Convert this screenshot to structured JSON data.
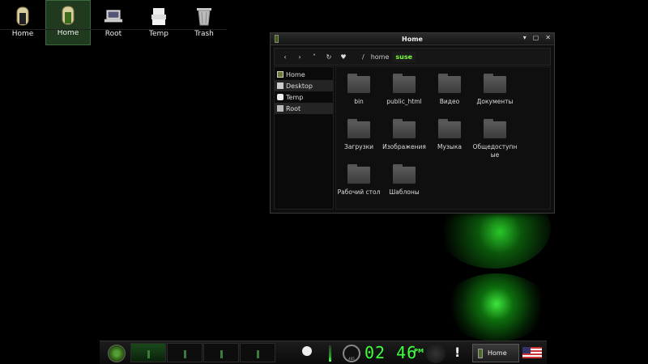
{
  "desktop": {
    "icons": [
      {
        "label": "Home"
      },
      {
        "label": "Home"
      },
      {
        "label": "Root"
      },
      {
        "label": "Temp"
      },
      {
        "label": "Trash"
      }
    ]
  },
  "window": {
    "title": "Home",
    "controls": {
      "minimize": "▾",
      "maximize": "▢",
      "close": "✕"
    },
    "toolbar": {
      "back": "‹",
      "forward": "›",
      "up": "˄",
      "reload": "↻",
      "bookmark": "♥",
      "separator": "/",
      "breadcrumb": [
        "home",
        "suse"
      ]
    },
    "sidebar": [
      {
        "label": "Home",
        "icon": "home-icon"
      },
      {
        "label": "Desktop",
        "icon": "desktop-icon"
      },
      {
        "label": "Temp",
        "icon": "temp-icon"
      },
      {
        "label": "Root",
        "icon": "root-icon"
      }
    ],
    "files": [
      "bin",
      "public_html",
      "Видео",
      "Документы",
      "Загрузки",
      "Изображения",
      "Музыка",
      "Общедоступные",
      "Рабочий стол",
      "Шаблоны"
    ]
  },
  "taskbar": {
    "clock": "02 46",
    "ampm": "PM",
    "gauge_label": "465",
    "task_label": "Home",
    "excl": "!"
  },
  "colors": {
    "accent": "#3fff3f",
    "background": "#000000",
    "selection": "#1f3a1f"
  }
}
